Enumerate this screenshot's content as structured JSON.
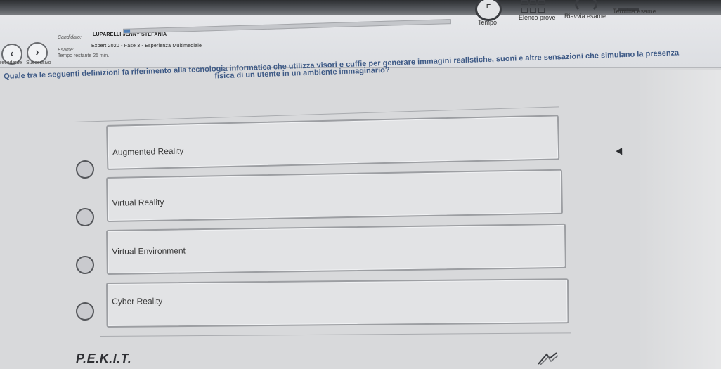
{
  "nav": {
    "prev_label": "recedente",
    "next_label": "Successivo"
  },
  "exam_info": {
    "candidate_label": "Candidato:",
    "candidate_name": "LUPARELLI JENNY STEFANIA",
    "exam_label": "Esame:",
    "exam_name": "Expert 2020 - Fase 3 - Esperienza Multimediale",
    "time_remaining": "Tempo restante 25 min."
  },
  "toolbar": {
    "tempo_label": "Tempo",
    "elenco_label": "Elenco prove",
    "riavvia_label": "Riavvia esame",
    "termina_label": "Termina esame"
  },
  "question": {
    "line1": "Quale tra le seguenti definizioni fa riferimento alla tecnologia informatica che utilizza visori e cuffie per generare immagini realistiche, suoni e altre sensazioni che simulano la presenza",
    "line2": "fisica di un utente in un ambiente immaginario?"
  },
  "answers": [
    {
      "label": "Augmented Reality"
    },
    {
      "label": "Virtual Reality"
    },
    {
      "label": "Virtual Environment"
    },
    {
      "label": "Cyber Reality"
    }
  ],
  "footer": {
    "brand": "P.E.K.I.T."
  },
  "colors": {
    "question_text": "#3e5a86",
    "accent": "#4f7fb8"
  },
  "icons": {
    "prev": "chevron-left-icon",
    "next": "chevron-right-icon",
    "timer": "clock-icon",
    "list": "grid-icon",
    "restart": "refresh-icon",
    "end": "exit-icon"
  }
}
